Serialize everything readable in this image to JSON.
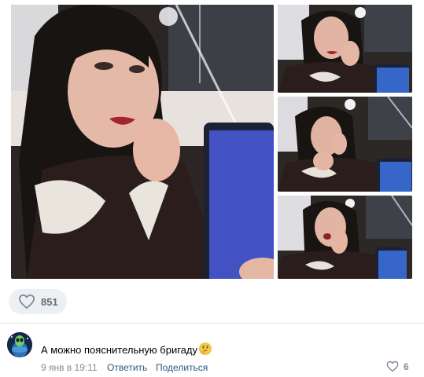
{
  "post": {
    "photos": [
      "photo-main",
      "photo-thumb-1",
      "photo-thumb-2",
      "photo-thumb-3"
    ],
    "likes": "851",
    "like_icon": "heart-outline-icon"
  },
  "comment": {
    "avatar_icon": "alien-globe-avatar",
    "text": "А можно пояснительную бригаду",
    "emoji_icon": "thinking-face-emoji",
    "date": "9 янв в 19:11",
    "reply_label": "Ответить",
    "share_label": "Поделиться",
    "likes": "6"
  },
  "colors": {
    "link": "#2a5885",
    "meta": "#818c99",
    "pill_bg": "#edf0f3"
  }
}
